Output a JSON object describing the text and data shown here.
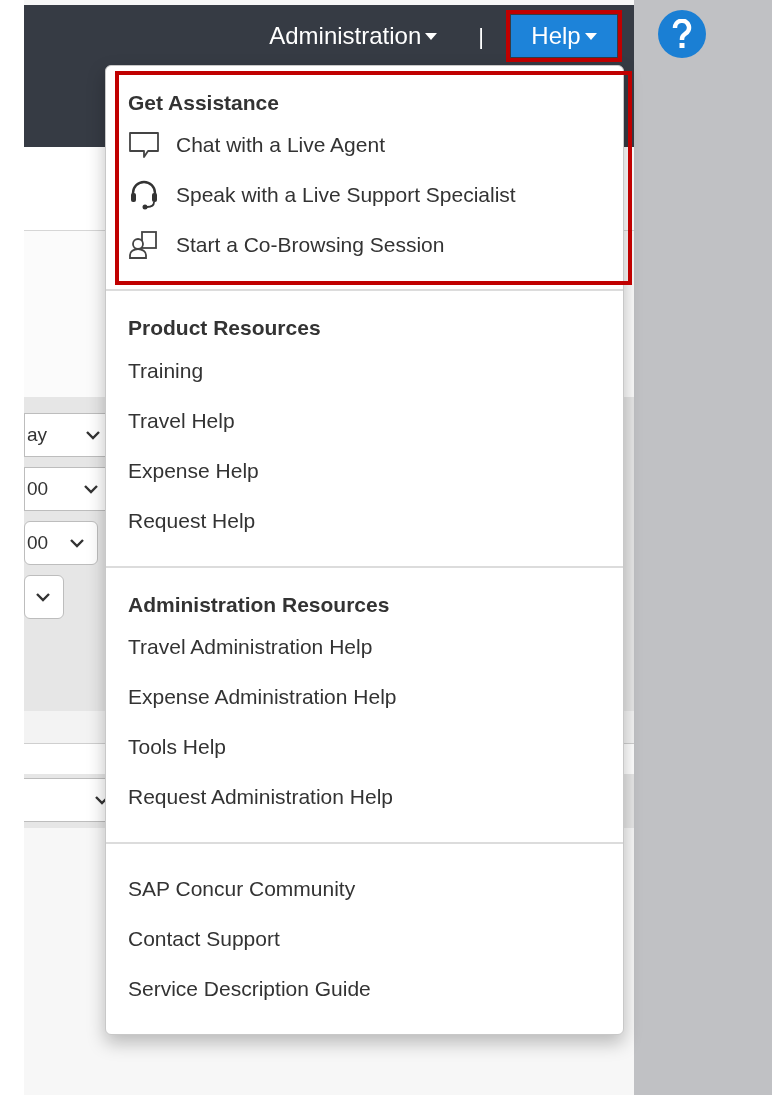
{
  "header": {
    "nav": [
      {
        "label": "Administration",
        "selected": false
      },
      {
        "label": "Help",
        "selected": true
      }
    ],
    "separator": "|"
  },
  "background_form": {
    "fields": [
      {
        "value": "ay"
      },
      {
        "value": "00"
      },
      {
        "value": "00"
      }
    ]
  },
  "help_menu": {
    "sections": [
      {
        "heading": "Get Assistance",
        "items": [
          {
            "label": "Chat with a Live Agent"
          },
          {
            "label": "Speak with a Live Support Specialist"
          },
          {
            "label": "Start a Co-Browsing Session"
          }
        ]
      },
      {
        "heading": "Product Resources",
        "items": [
          {
            "label": "Training"
          },
          {
            "label": "Travel Help"
          },
          {
            "label": "Expense Help"
          },
          {
            "label": "Request Help"
          }
        ]
      },
      {
        "heading": "Administration Resources",
        "items": [
          {
            "label": "Travel Administration Help"
          },
          {
            "label": "Expense Administration Help"
          },
          {
            "label": "Tools Help"
          },
          {
            "label": "Request Administration Help"
          }
        ]
      },
      {
        "items": [
          {
            "label": "SAP Concur Community"
          },
          {
            "label": "Contact Support"
          },
          {
            "label": "Service Description Guide"
          }
        ]
      }
    ]
  }
}
